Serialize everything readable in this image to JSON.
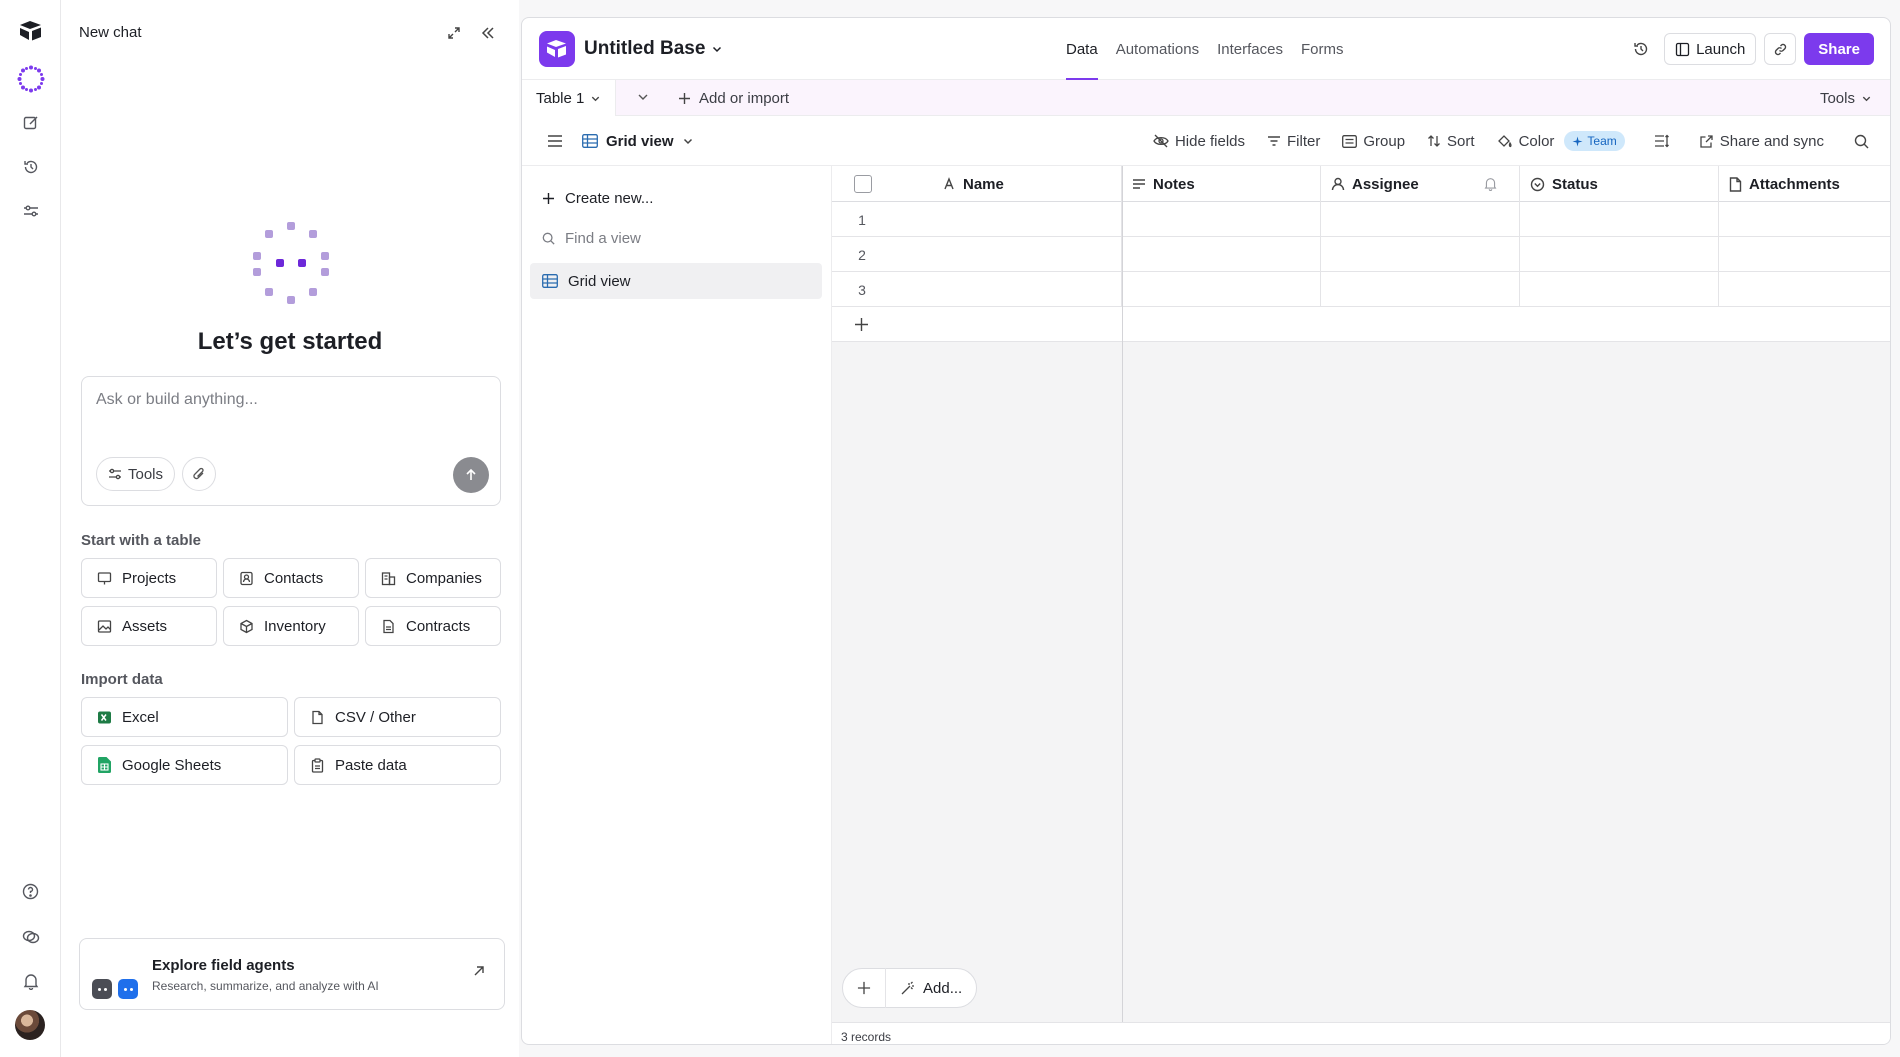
{
  "chat": {
    "title": "New chat",
    "heading": "Let’s get started",
    "placeholder": "Ask or build anything...",
    "tools_label": "Tools",
    "start_label": "Start with a table",
    "templates": [
      "Projects",
      "Contacts",
      "Companies",
      "Assets",
      "Inventory",
      "Contracts"
    ],
    "import_label": "Import data",
    "imports": [
      "Excel",
      "CSV / Other",
      "Google Sheets",
      "Paste data"
    ],
    "agents_title": "Explore field agents",
    "agents_sub": "Research, summarize, and analyze with AI"
  },
  "base": {
    "name": "Untitled Base",
    "nav": [
      "Data",
      "Automations",
      "Interfaces",
      "Forms"
    ],
    "active_nav": "Data",
    "launch_label": "Launch",
    "share_label": "Share",
    "accent": "#7c3aed"
  },
  "tablebar": {
    "table_name": "Table 1",
    "add_import": "Add or import",
    "tools": "Tools"
  },
  "viewbar": {
    "view_name": "Grid view",
    "hide_fields": "Hide fields",
    "filter": "Filter",
    "group": "Group",
    "sort": "Sort",
    "color": "Color",
    "team_badge": "Team",
    "share_sync": "Share and sync"
  },
  "views": {
    "create_new": "Create new...",
    "find_placeholder": "Find a view",
    "items": [
      "Grid view"
    ]
  },
  "grid": {
    "columns": [
      "Name",
      "Notes",
      "Assignee",
      "Status",
      "Attachments"
    ],
    "rows": [
      "1",
      "2",
      "3"
    ],
    "add_label": "Add...",
    "records": "3 records"
  }
}
